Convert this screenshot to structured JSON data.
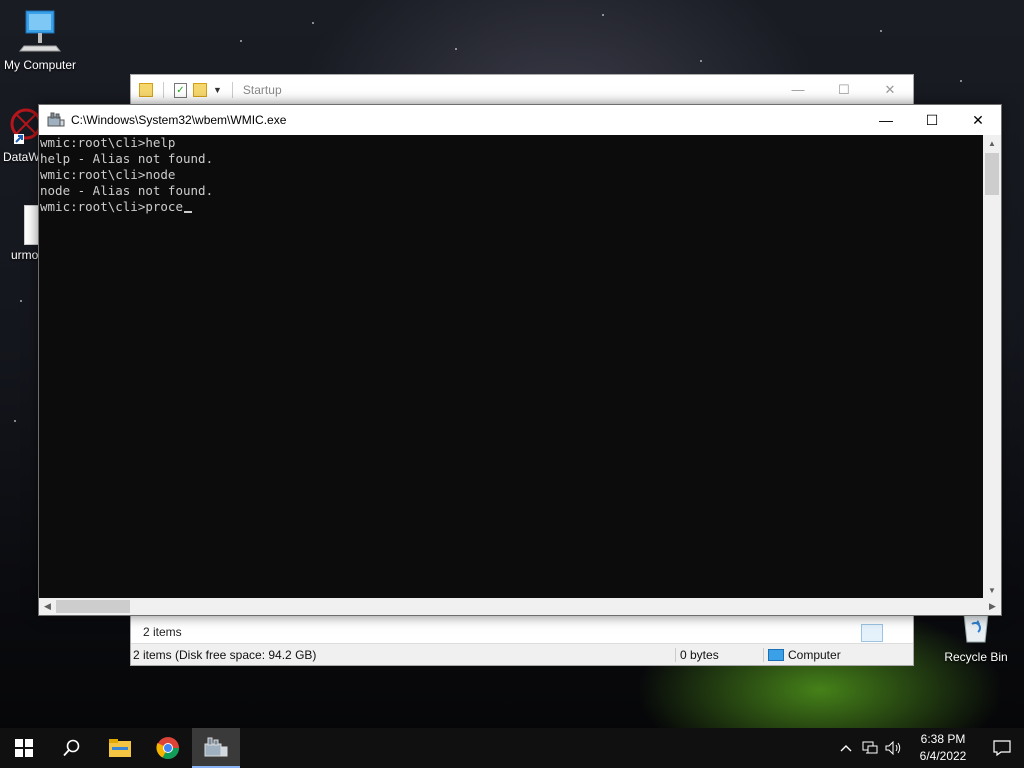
{
  "desktop": {
    "icons": [
      {
        "label": "My Computer"
      },
      {
        "label": "DataW"
      },
      {
        "label": "urmo"
      },
      {
        "label": "Recycle Bin"
      }
    ]
  },
  "explorer": {
    "title": "Startup",
    "controls": {
      "minimize": "—",
      "maximize": "☐",
      "close": "✕"
    },
    "status_items": "2 items",
    "details": {
      "items_free": "2 items (Disk free space: 94.2 GB)",
      "size": "0 bytes",
      "location": "Computer"
    }
  },
  "console": {
    "title": "C:\\Windows\\System32\\wbem\\WMIC.exe",
    "controls": {
      "minimize": "—",
      "maximize": "☐",
      "close": "✕"
    },
    "lines": [
      "wmic:root\\cli>help",
      "help - Alias not found.",
      "wmic:root\\cli>node",
      "node - Alias not found.",
      "wmic:root\\cli>proce"
    ]
  },
  "taskbar": {
    "apps": [
      "start-icon",
      "search-icon",
      "file-explorer-icon",
      "chrome-icon",
      "wmic-icon"
    ],
    "clock": {
      "time": "6:38 PM",
      "date": "6/4/2022"
    }
  },
  "colors": {
    "console_bg": "#0c0c0c",
    "console_fg": "#cccccc",
    "taskbar_bg": "#101010"
  }
}
